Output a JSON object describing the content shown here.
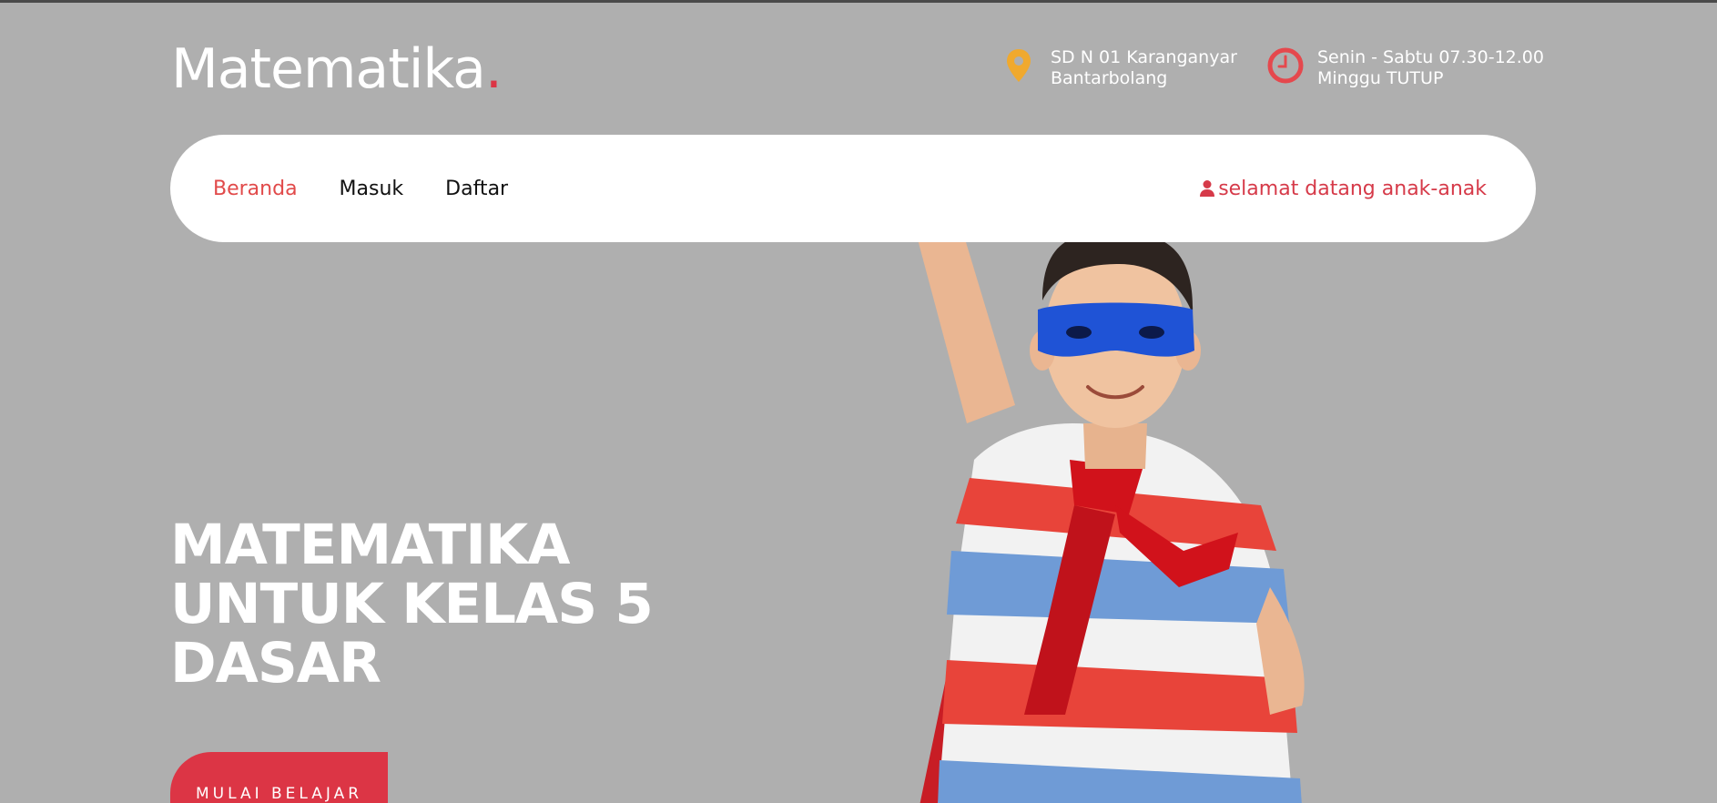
{
  "brand": {
    "name": "Matematika",
    "dot": ".",
    "dot_color": "#dc3545"
  },
  "header_info": {
    "location": {
      "icon": "map-pin-icon",
      "line1": "SD N 01 Karanganyar",
      "line2": "Bantarbolang"
    },
    "hours": {
      "icon": "clock-icon",
      "line1": "Senin - Sabtu 07.30-12.00",
      "line2": "Minggu TUTUP"
    }
  },
  "nav": {
    "items": [
      {
        "label": "Beranda",
        "active": true
      },
      {
        "label": "Masuk",
        "active": false
      },
      {
        "label": "Daftar",
        "active": false
      }
    ],
    "greeting": {
      "icon": "user-icon",
      "text": "selamat datang anak-anak"
    }
  },
  "hero": {
    "title": "MATEMATIKA\nUNTUK KELAS 5\nDASAR",
    "cta_label": "MULAI BELAJAR",
    "image": "boy-superhero-illustration"
  },
  "colors": {
    "background": "#afafaf",
    "accent": "#dc3545",
    "active_nav": "#e14a4a",
    "pin": "#f0a92e"
  }
}
